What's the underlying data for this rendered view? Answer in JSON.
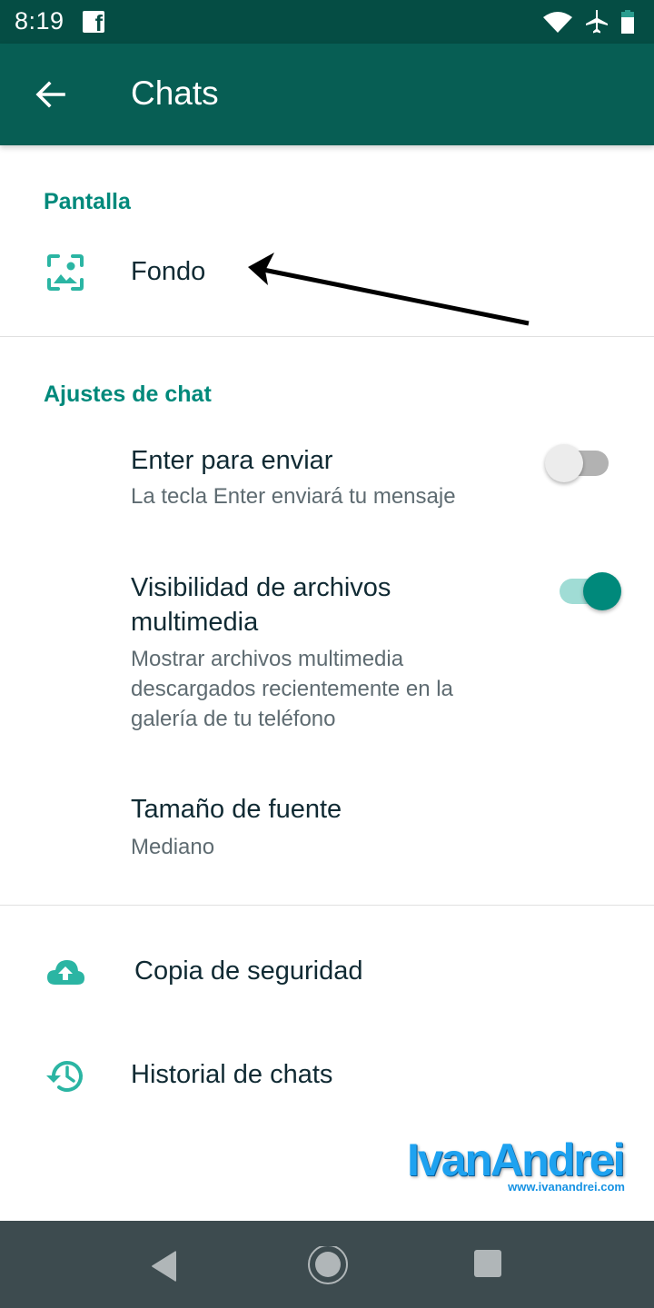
{
  "status_bar": {
    "time": "8:19",
    "notification_icon": "facebook-icon",
    "icons": [
      "wifi-icon",
      "airplane-mode-icon",
      "battery-icon"
    ]
  },
  "app_bar": {
    "back_icon": "arrow-back-icon",
    "title": "Chats"
  },
  "sections": {
    "display": {
      "header": "Pantalla",
      "items": [
        {
          "icon": "wallpaper-icon",
          "title": "Fondo"
        }
      ]
    },
    "chat_settings": {
      "header": "Ajustes de chat",
      "items": [
        {
          "title": "Enter para enviar",
          "subtitle": "La tecla Enter enviará tu mensaje",
          "toggle": false
        },
        {
          "title_line1": "Visibilidad de archivos",
          "title_line2": "multimedia",
          "subtitle_line1": "Mostrar archivos multimedia",
          "subtitle_line2": "descargados recientemente en la",
          "subtitle_line3": "galería de tu teléfono",
          "toggle": true
        },
        {
          "title": "Tamaño de fuente",
          "subtitle": "Mediano"
        }
      ]
    },
    "other": {
      "items": [
        {
          "icon": "cloud-upload-icon",
          "title": "Copia de seguridad"
        },
        {
          "icon": "history-icon",
          "title": "Historial de chats"
        }
      ]
    }
  },
  "annotation": {
    "type": "arrow",
    "points_to": "Fondo"
  },
  "watermark": {
    "brand": "IvanAndrei",
    "url": "www.ivanandrei.com"
  },
  "nav_bar": {
    "buttons": [
      "back",
      "home",
      "recents"
    ]
  },
  "colors": {
    "status_bar": "#054d44",
    "app_bar": "#075e54",
    "accent": "#00897b",
    "icon_teal": "#2bb5a3",
    "nav_bar": "#3d4b4f"
  }
}
